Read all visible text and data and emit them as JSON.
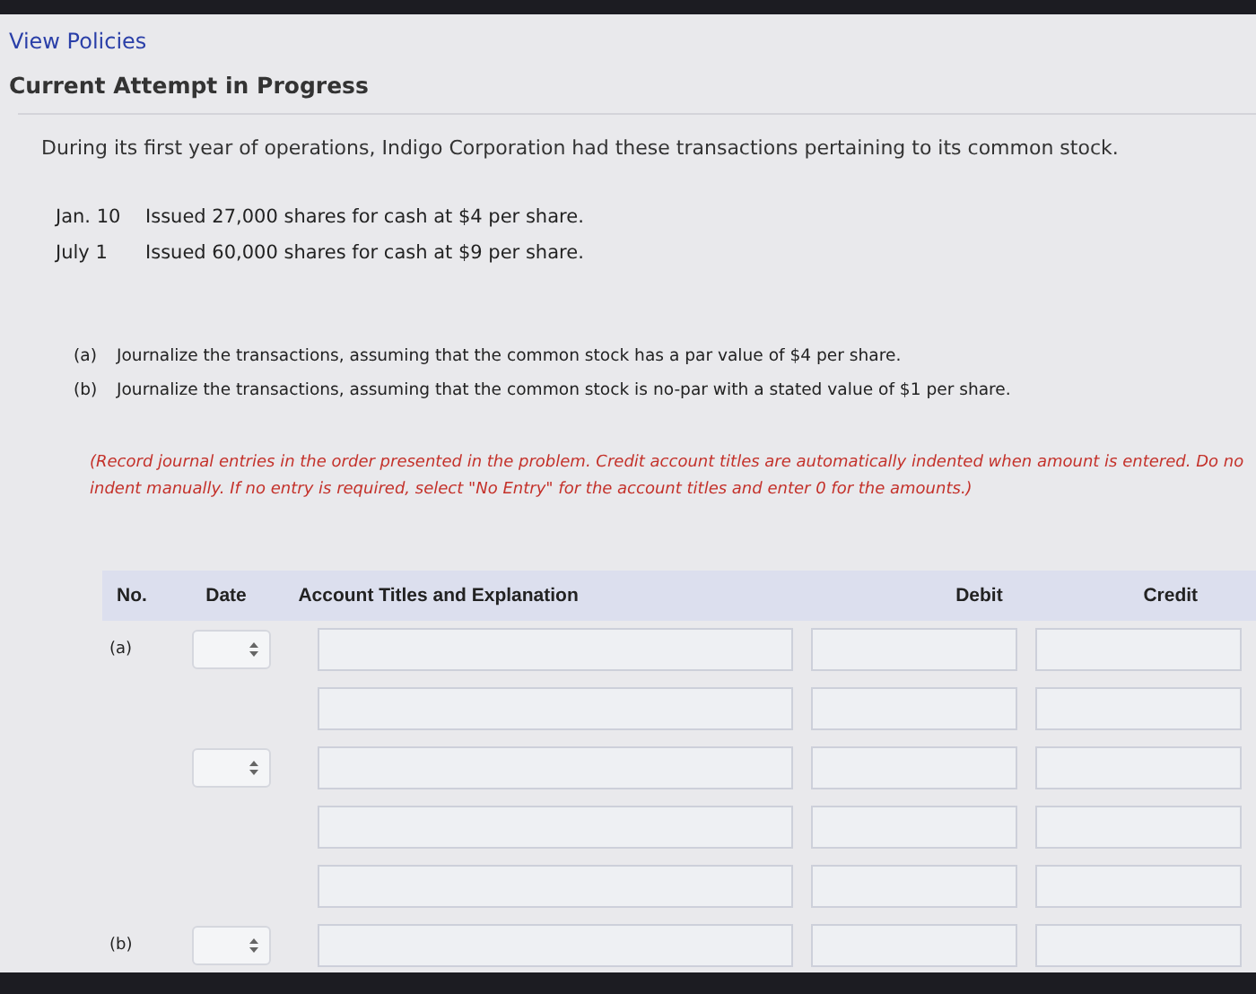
{
  "link": "View Policies",
  "heading": "Current Attempt in Progress",
  "intro": "During its first year of operations, Indigo Corporation had these transactions pertaining to its common stock.",
  "transactions": [
    {
      "date": "Jan. 10",
      "text": "Issued 27,000 shares for cash at $4 per share."
    },
    {
      "date": "July 1",
      "text": "Issued 60,000 shares for cash at $9 per share."
    }
  ],
  "parts": [
    {
      "label": "(a)",
      "text": "Journalize the transactions, assuming that the common stock has a par value of $4 per share."
    },
    {
      "label": "(b)",
      "text": "Journalize the transactions, assuming that the common stock is no-par with a stated value of $1 per share."
    }
  ],
  "instruction_lines": [
    "(Record journal entries in the order presented in the problem. Credit account titles are automatically indented when amount is entered. Do no",
    "indent manually. If no entry is required, select \"No Entry\" for the account titles and enter 0 for the amounts.)"
  ],
  "table": {
    "columns": [
      "No.",
      "Date",
      "Account Titles and Explanation",
      "Debit",
      "Credit"
    ],
    "rows": [
      {
        "no": "(a)",
        "date_select": true
      },
      {
        "date_select": false
      },
      {
        "date_select": true
      },
      {
        "date_select": false
      },
      {
        "date_select": false
      },
      {
        "no": "(b)",
        "date_select": true
      }
    ]
  }
}
